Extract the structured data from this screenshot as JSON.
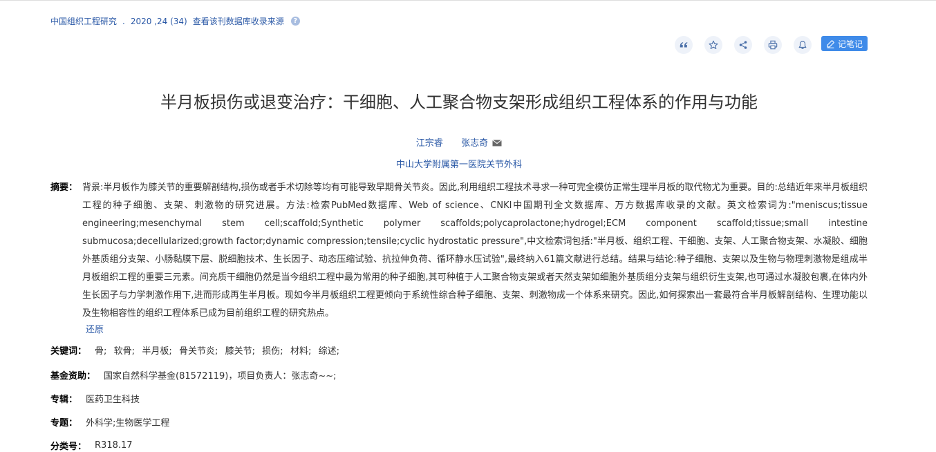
{
  "source": {
    "journal": "中国组织工程研究",
    "dot": ".",
    "issue": "2020 ,24 (34)",
    "db_link": "查看该刊数据库收录来源",
    "help_icon": "?"
  },
  "toolbar": {
    "icons": [
      "quote-icon",
      "star-icon",
      "share-icon",
      "print-icon",
      "bell-icon"
    ],
    "note_label": "记笔记"
  },
  "article": {
    "title": "半月板损伤或退变治疗：干细胞、人工聚合物支架形成组织工程体系的作用与功能",
    "authors": [
      "江宗睿",
      "张志奇"
    ],
    "affiliation": "中山大学附属第一医院关节外科"
  },
  "abstract": {
    "label": "摘要：",
    "text": "背景:半月板作为膝关节的重要解剖结构,损伤或者手术切除等均有可能导致早期骨关节炎。因此,利用组织工程技术寻求一种可完全模仿正常生理半月板的取代物尤为重要。目的:总结近年来半月板组织工程的种子细胞、支架、刺激物的研究进展。方法:检索PubMed数据库、Web of science、CNKI中国期刊全文数据库、万方数据库收录的文献。英文检索词为:\"meniscus;tissue engineering;mesenchymal stem cell;scaffold;Synthetic polymer scaffolds;polycaprolactone;hydrogel;ECM component scaffold;tissue;small intestine submucosa;decellularized;growth factor;dynamic compression;tensile;cyclic hydrostatic pressure\",中文检索词包括:\"半月板、组织工程、干细胞、支架、人工聚合物支架、水凝胶、细胞外基质组分支架、小肠黏膜下层、脱细胞技术、生长因子、动态压缩试验、抗拉伸负荷、循环静水压试验\",最终纳入61篇文献进行总结。结果与结论:种子细胞、支架以及生物与物理刺激物是组成半月板组织工程的重要三元素。间充质干细胞仍然是当今组织工程中最为常用的种子细胞,其可种植于人工聚合物支架或者天然支架如细胞外基质组分支架与组织衍生支架,也可通过水凝胶包裹,在体内外生长因子与力学刺激作用下,进而形成再生半月板。现如今半月板组织工程更倾向于系统性综合种子细胞、支架、刺激物成一个体系来研究。因此,如何探索出一套最符合半月板解剖结构、生理功能以及生物相容性的组织工程体系已成为目前组织工程的研究热点。",
    "restore": "还原"
  },
  "meta": {
    "keywords_label": "关键词：",
    "keywords": [
      "骨;",
      "软骨;",
      "半月板;",
      "骨关节炎;",
      "膝关节;",
      "损伤;",
      "材料;",
      "综述;"
    ],
    "fund_label": "基金资助：",
    "fund": "国家自然科学基金(81572119)，项目负责人：张志奇~~;",
    "album_label": "专辑：",
    "album": "医药卫生科技",
    "topic_label": "专题：",
    "topic": "外科学;生物医学工程",
    "class_label": "分类号：",
    "class_no": "R318.17"
  },
  "colors": {
    "link": "#2a58a6",
    "accent_button": "#3f8be9",
    "icon_bg": "#eef2f9"
  }
}
